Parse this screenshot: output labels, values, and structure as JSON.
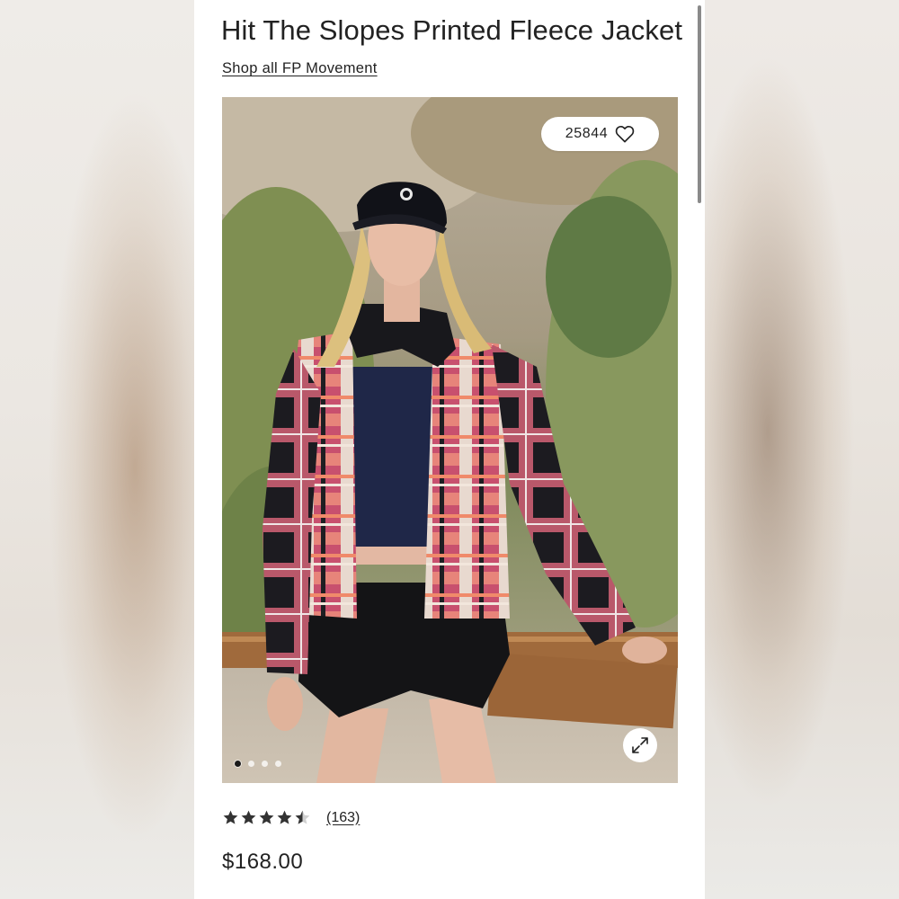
{
  "product": {
    "title": "Hit The Slopes Printed Fleece Jacket",
    "shop_link": "Shop all FP Movement",
    "likes": "25844",
    "rating": 4.5,
    "rating_max": 5,
    "review_count": "(163)",
    "price": "$168.00"
  },
  "gallery": {
    "image_count": 4,
    "active_index": 0
  },
  "icons": {
    "like": "heart-icon",
    "expand": "expand-arrows-icon",
    "star": "star-icon"
  },
  "colors": {
    "text": "#222222",
    "background": "#ffffff",
    "star": "#333333"
  }
}
